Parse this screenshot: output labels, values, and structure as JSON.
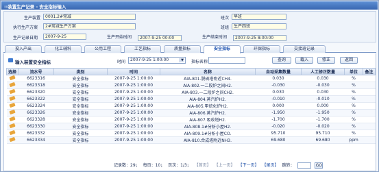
{
  "window": {
    "title": "::装置生产记录 - 安全指标输入"
  },
  "form": {
    "device_label": "生产装置",
    "device_value": "0001.2#常减",
    "shift_label": "班次",
    "shift_value": "早班",
    "plan_label": "执行生产方案",
    "plan_value": "2#常减生产方案",
    "team_label": "班组",
    "team_value": "生产四班",
    "date_label": "生产记录日期",
    "date_value": "2007-9-25",
    "start_label": "生产开始时间",
    "start_value": "2007-9-25 00:00",
    "end_label": "生产结束时间",
    "end_value": "2007-9-25 8:00:00"
  },
  "tabs": [
    "投入产出",
    "化工辅料",
    "公用工程",
    "工艺指标",
    "质量指标",
    "安全指标",
    "环保指标",
    "交接班记录"
  ],
  "active_tab_index": 5,
  "section": {
    "title": "输入装置安全指标",
    "time_label": "时间",
    "time_value": "2007-9-25 1:00:00",
    "name_label": "指标名称",
    "name_value": "",
    "query_btn": "查询",
    "load_btn": "载入",
    "edit_btn": "修正",
    "back_btn": "返回"
  },
  "table": {
    "columns": [
      "选择",
      "流水号",
      "类别",
      "时间",
      "名称",
      "自动采集数量",
      "人工修正数量",
      "单位",
      "备注"
    ],
    "rows": [
      [
        "6623316",
        "安全指标",
        "2007-9-25 1:00:00",
        "AIA-801.脱硫塔附近CH4.",
        "0.030",
        "0.030",
        "%",
        ""
      ],
      [
        "6623318",
        "安全指标",
        "2007-9-25 1:00:00",
        "AIA-802.一二段炉之间H2.",
        "-0.030",
        "-0.030",
        "%",
        ""
      ],
      [
        "6623320",
        "安全指标",
        "2007-9-25 1:00:00",
        "AIA-803.一二段炉之间CH2.",
        "0.030",
        "0.030",
        "%",
        ""
      ],
      [
        "6623322",
        "安全指标",
        "2007-9-25 1:00:00",
        "AIA-804.蒸汽炉H2.",
        "-0.010",
        "-0.010",
        "%",
        ""
      ],
      [
        "6623324",
        "安全指标",
        "2007-9-25 1:00:00",
        "AIA-805.甲烷化炉H2.",
        "0.000",
        "0.000",
        "%",
        ""
      ],
      [
        "6623326",
        "安全指标",
        "2007-9-25 1:00:00",
        "AIA-806.蒸汽炉H2.",
        "-1.950",
        "-1.950",
        "%",
        ""
      ],
      [
        "6623328",
        "安全指标",
        "2007-9-25 1:00:00",
        "AIA-807.吸收塔H2.",
        "-1.700",
        "-1.700",
        "%",
        ""
      ],
      [
        "6623330",
        "安全指标",
        "2007-9-25 1:00:00",
        "AIA-808.1#分析小屋H2.",
        "-0.020",
        "-0.020",
        "%",
        ""
      ],
      [
        "6623332",
        "安全指标",
        "2007-9-25 1:00:00",
        "AIA-809.1#分析小屋CO.",
        "95.710",
        "95.710",
        "%",
        ""
      ],
      [
        "6623334",
        "安全指标",
        "2007-9-25 1:00:00",
        "AIA-810.合成塔附近NH3.",
        "69.680",
        "69.680",
        "ppm",
        ""
      ]
    ]
  },
  "pager": {
    "records": "记录数：29；",
    "per_page": "每页：10；",
    "page_info": "页次：1/3；",
    "first": "【首页】",
    "prev": "【上一页】",
    "next": "【下一页】",
    "last": "【尾页】",
    "jump": "跳转：",
    "go": "GO"
  }
}
